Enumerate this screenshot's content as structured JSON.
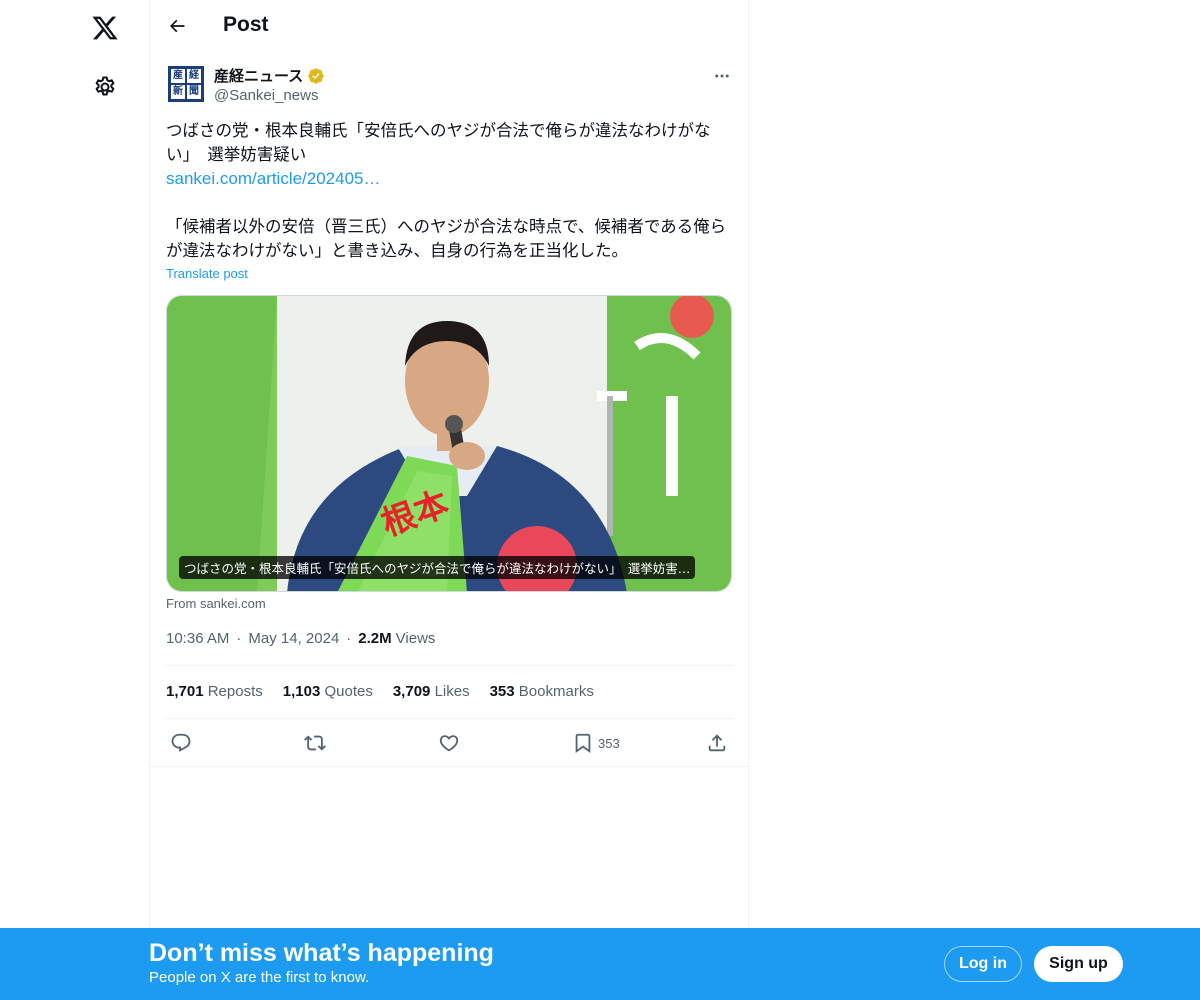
{
  "nav": {
    "logo_icon": "x-logo-icon",
    "settings_icon": "gear-icon"
  },
  "header": {
    "title": "Post",
    "back_icon": "arrow-left-icon"
  },
  "author": {
    "avatar_chars": [
      "産",
      "経",
      "新",
      "聞"
    ],
    "name": "産経ニュース",
    "handle": "@Sankei_news",
    "verified_color": "#e2b719"
  },
  "post": {
    "text_line1": "つばさの党・根本良輔氏「安倍氏へのヤジが合法で俺らが違法なわけがない」　選挙妨害疑い",
    "link": "sankei.com/article/202405…",
    "text_line2": "「候補者以外の安倍（晋三氏）へのヤジが合法な時点で、候補者である俺らが違法なわけがない」と書き込み、自身の行為を正当化した。",
    "translate": "Translate post"
  },
  "card": {
    "caption": "つばさの党・根本良輔氏「安倍氏へのヤジが合法で俺らが違法なわけがない」　選挙妨害…",
    "source": "From sankei.com"
  },
  "meta": {
    "time": "10:36 AM",
    "date": "May 14, 2024",
    "views_value": "2.2M",
    "views_label": "Views"
  },
  "stats": {
    "reposts_value": "1,701",
    "reposts_label": "Reposts",
    "quotes_value": "1,103",
    "quotes_label": "Quotes",
    "likes_value": "3,709",
    "likes_label": "Likes",
    "bookmarks_value": "353",
    "bookmarks_label": "Bookmarks"
  },
  "actions": {
    "bookmark_count": "353"
  },
  "banner": {
    "title": "Don’t miss what’s happening",
    "subtitle": "People on X are the first to know.",
    "login": "Log in",
    "signup": "Sign up"
  },
  "colors": {
    "accent": "#1d9bf0",
    "text": "#0f1419",
    "secondary": "#536471",
    "border": "#eff3f4"
  }
}
